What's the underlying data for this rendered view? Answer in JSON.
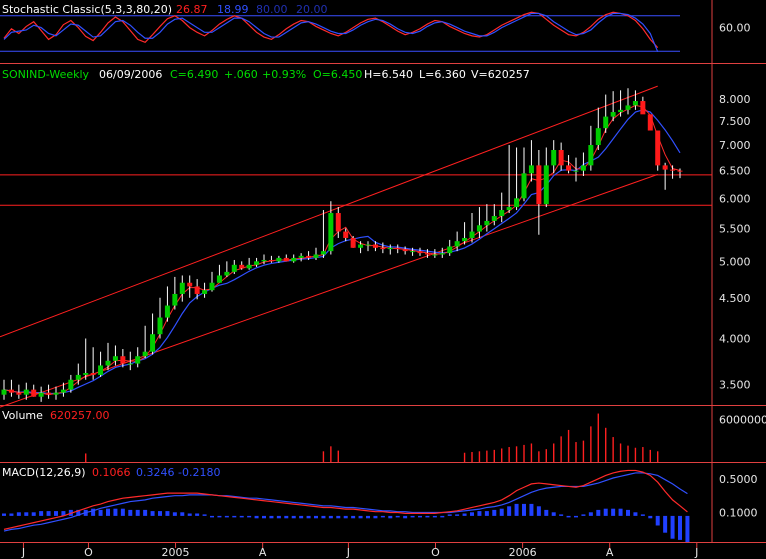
{
  "colors": {
    "background": "#000000",
    "up": "#00cc00",
    "down": "#ff1a1a",
    "channel": "#ff2020",
    "ma_fast": "#ff2a2a",
    "ma_slow": "#3050ff",
    "axis_text": "#e6e6e6",
    "header_text": "#ffffff",
    "price_header": "#00dd00"
  },
  "stoch_panel": {
    "label": "Stochastic Classic(5,3,3,80,20)",
    "k": "26.87",
    "d": "18.99",
    "upper": "80.00",
    "lower": "20.00"
  },
  "price_panel": {
    "symbol": "SONIND-Weekly",
    "date": "06/09/2006",
    "close": "C=6.490",
    "change": "+.060",
    "pct": "+0.93%",
    "open": "O=6.450",
    "high": "H=6.540",
    "low": "L=6.360",
    "volume": "V=620257"
  },
  "volume_panel": {
    "label": "Volume",
    "value": "620257.00"
  },
  "macd_panel": {
    "label": "MACD(12,26,9)",
    "macd": "0.1066",
    "signal": "0.3246",
    "hist": "-0.2180"
  },
  "chart_data": [
    {
      "type": "line",
      "panel": "stochastic",
      "y_ticks": [
        "60.00"
      ],
      "ylim": [
        0,
        100
      ],
      "reference_lines": [
        80,
        20
      ],
      "series": [
        {
          "values": [
            42,
            58,
            50,
            62,
            70,
            55,
            40,
            48,
            65,
            72,
            60,
            45,
            38,
            52,
            68,
            78,
            70,
            55,
            40,
            35,
            48,
            62,
            75,
            80,
            72,
            60,
            52,
            46,
            55,
            66,
            74,
            80,
            76,
            64,
            52,
            44,
            40,
            48,
            58,
            66,
            72,
            70,
            62,
            56,
            50,
            46,
            52,
            60,
            68,
            74,
            76,
            70,
            62,
            54,
            48,
            52,
            58,
            66,
            72,
            70,
            62,
            56,
            50,
            46,
            44,
            48,
            56,
            64,
            70,
            76,
            82,
            86,
            84,
            74,
            64,
            56,
            48,
            46,
            52,
            62,
            74,
            82,
            86,
            84,
            80,
            72,
            58,
            40,
            26
          ]
        },
        {
          "values": [
            40,
            52,
            54,
            56,
            64,
            60,
            50,
            46,
            56,
            66,
            64,
            54,
            44,
            46,
            58,
            70,
            72,
            64,
            52,
            42,
            42,
            52,
            66,
            74,
            76,
            68,
            60,
            52,
            52,
            60,
            68,
            76,
            76,
            70,
            60,
            50,
            44,
            44,
            52,
            60,
            68,
            70,
            66,
            60,
            54,
            50,
            50,
            56,
            64,
            70,
            74,
            72,
            66,
            58,
            52,
            50,
            54,
            62,
            68,
            70,
            66,
            60,
            54,
            50,
            46,
            46,
            52,
            60,
            66,
            72,
            78,
            84,
            84,
            80,
            70,
            62,
            54,
            48,
            50,
            56,
            68,
            78,
            84,
            84,
            82,
            76,
            66,
            50,
            19
          ]
        }
      ]
    },
    {
      "type": "candlestick",
      "panel": "price",
      "y_ticks": [
        "8.000",
        "7.500",
        "7.000",
        "6.500",
        "6.000",
        "5.500",
        "5.000",
        "4.500",
        "4.000",
        "3.500"
      ],
      "x_ticks": [
        "J",
        "O",
        "2005",
        "A",
        "J",
        "O",
        "2006",
        "A",
        "J"
      ],
      "scale": "log",
      "ylim": [
        3.3,
        8.4
      ],
      "horizontal_lines": [
        6.42,
        5.88
      ],
      "channel": [
        {
          "from": [
            0,
            4.02
          ],
          "to": [
            88,
            8.3
          ]
        },
        {
          "from": [
            0,
            3.28
          ],
          "to": [
            88,
            6.43
          ]
        }
      ],
      "opens": [
        3.4,
        3.45,
        3.42,
        3.4,
        3.45,
        3.38,
        3.42,
        3.4,
        3.42,
        3.45,
        3.55,
        3.6,
        3.62,
        3.6,
        3.7,
        3.75,
        3.8,
        3.72,
        3.72,
        3.8,
        3.85,
        4.05,
        4.25,
        4.4,
        4.55,
        4.7,
        4.65,
        4.55,
        4.6,
        4.7,
        4.8,
        4.85,
        4.95,
        4.9,
        4.95,
        5.0,
        5.02,
        5.0,
        5.05,
        5.0,
        5.05,
        5.08,
        5.05,
        5.1,
        5.15,
        5.75,
        5.45,
        5.35,
        5.2,
        5.25,
        5.25,
        5.2,
        5.18,
        5.2,
        5.18,
        5.15,
        5.15,
        5.12,
        5.1,
        5.1,
        5.12,
        5.22,
        5.3,
        5.35,
        5.45,
        5.55,
        5.62,
        5.7,
        5.8,
        5.85,
        6.0,
        6.45,
        6.6,
        5.9,
        6.6,
        6.9,
        6.6,
        6.5,
        6.5,
        6.6,
        7.0,
        7.35,
        7.6,
        7.7,
        7.75,
        7.85,
        7.95,
        7.65,
        7.3,
        6.6,
        6.52,
        6.5
      ],
      "highs": [
        3.55,
        3.55,
        3.5,
        3.52,
        3.5,
        3.48,
        3.5,
        3.48,
        3.52,
        3.6,
        3.72,
        4.0,
        3.9,
        3.85,
        3.95,
        3.92,
        3.88,
        3.85,
        3.9,
        4.15,
        4.3,
        4.5,
        4.65,
        4.78,
        4.8,
        4.8,
        4.75,
        4.7,
        4.85,
        4.95,
        5.0,
        5.02,
        5.0,
        5.05,
        5.05,
        5.1,
        5.08,
        5.08,
        5.1,
        5.1,
        5.12,
        5.15,
        5.2,
        5.8,
        5.95,
        5.85,
        5.5,
        5.38,
        5.3,
        5.3,
        5.3,
        5.28,
        5.25,
        5.25,
        5.22,
        5.2,
        5.2,
        5.18,
        5.18,
        5.2,
        5.32,
        5.45,
        5.6,
        5.75,
        5.85,
        5.9,
        5.9,
        6.1,
        7.0,
        6.95,
        6.95,
        7.1,
        6.9,
        6.95,
        7.1,
        7.05,
        6.8,
        6.75,
        6.85,
        7.4,
        7.8,
        8.1,
        8.18,
        8.2,
        8.25,
        8.2,
        8.05,
        7.5,
        6.7,
        6.65,
        6.6,
        6.54
      ],
      "lows": [
        3.35,
        3.38,
        3.36,
        3.35,
        3.38,
        3.33,
        3.36,
        3.35,
        3.38,
        3.42,
        3.5,
        3.55,
        3.55,
        3.58,
        3.65,
        3.7,
        3.68,
        3.65,
        3.68,
        3.78,
        3.82,
        4.0,
        4.2,
        4.35,
        4.45,
        4.5,
        4.48,
        4.5,
        4.58,
        4.7,
        4.78,
        4.82,
        4.88,
        4.88,
        4.92,
        4.96,
        4.98,
        4.98,
        5.0,
        4.98,
        5.0,
        5.02,
        5.02,
        5.05,
        5.1,
        5.35,
        5.3,
        5.2,
        5.12,
        5.15,
        5.15,
        5.12,
        5.1,
        5.12,
        5.1,
        5.08,
        5.08,
        5.05,
        5.05,
        5.05,
        5.08,
        5.15,
        5.25,
        5.28,
        5.35,
        5.45,
        5.55,
        5.6,
        5.75,
        5.8,
        5.95,
        6.3,
        5.4,
        5.85,
        6.45,
        6.5,
        6.45,
        6.3,
        6.4,
        6.5,
        6.9,
        7.25,
        7.5,
        7.6,
        7.65,
        7.75,
        7.85,
        7.55,
        6.5,
        6.15,
        6.35,
        6.36
      ],
      "closes": [
        3.45,
        3.42,
        3.4,
        3.45,
        3.38,
        3.42,
        3.4,
        3.42,
        3.45,
        3.55,
        3.6,
        3.62,
        3.6,
        3.7,
        3.75,
        3.8,
        3.72,
        3.72,
        3.8,
        3.85,
        4.05,
        4.25,
        4.4,
        4.55,
        4.7,
        4.65,
        4.55,
        4.6,
        4.7,
        4.8,
        4.85,
        4.95,
        4.9,
        4.95,
        5.0,
        5.02,
        5.0,
        5.05,
        5.0,
        5.05,
        5.08,
        5.05,
        5.1,
        5.15,
        5.75,
        5.45,
        5.35,
        5.2,
        5.25,
        5.25,
        5.2,
        5.18,
        5.2,
        5.18,
        5.15,
        5.15,
        5.12,
        5.1,
        5.1,
        5.12,
        5.22,
        5.3,
        5.35,
        5.45,
        5.55,
        5.62,
        5.7,
        5.8,
        5.85,
        6.0,
        6.45,
        6.6,
        5.9,
        6.6,
        6.9,
        6.6,
        6.5,
        6.5,
        6.6,
        7.0,
        7.35,
        7.6,
        7.7,
        7.75,
        7.85,
        7.95,
        7.65,
        7.3,
        6.6,
        6.52,
        6.5,
        6.49
      ]
    },
    {
      "type": "bar",
      "panel": "volume",
      "y_ticks": [
        "6000000"
      ],
      "ylim": [
        0,
        8000000
      ],
      "values": [
        800000,
        900000,
        700000,
        850000,
        750000,
        600000,
        700000,
        800000,
        900000,
        1000000,
        1100000,
        1200000,
        1000000,
        900000,
        800000,
        850000,
        700000,
        650000,
        800000,
        900000,
        950000,
        1000000,
        1100000,
        1050000,
        900000,
        800000,
        750000,
        700000,
        800000,
        850000,
        900000,
        800000,
        700000,
        650000,
        700000,
        750000,
        700000,
        650000,
        700000,
        750000,
        800000,
        700000,
        850000,
        1500000,
        2200000,
        1600000,
        1000000,
        900000,
        800000,
        750000,
        700000,
        650000,
        700000,
        650000,
        600000,
        600000,
        650000,
        600000,
        650000,
        700000,
        900000,
        1100000,
        1300000,
        1400000,
        1500000,
        1600000,
        1700000,
        1900000,
        2100000,
        2200000,
        2400000,
        2600000,
        1500000,
        1800000,
        2600000,
        3600000,
        4500000,
        2800000,
        3000000,
        5000000,
        6800000,
        4800000,
        3500000,
        2600000,
        2300000,
        2000000,
        2100000,
        1700000,
        1500000,
        1100000,
        620257
      ]
    },
    {
      "type": "line",
      "panel": "macd",
      "y_ticks": [
        "0.5000",
        "0.1000"
      ],
      "ylim": [
        -0.25,
        0.7
      ],
      "series": [
        {
          "values": [
            -0.1,
            -0.08,
            -0.06,
            -0.04,
            -0.02,
            0.0,
            0.02,
            0.04,
            0.06,
            0.09,
            0.12,
            0.15,
            0.18,
            0.2,
            0.23,
            0.25,
            0.27,
            0.28,
            0.29,
            0.3,
            0.31,
            0.32,
            0.33,
            0.33,
            0.33,
            0.33,
            0.33,
            0.32,
            0.31,
            0.3,
            0.29,
            0.28,
            0.27,
            0.26,
            0.25,
            0.24,
            0.23,
            0.22,
            0.21,
            0.2,
            0.19,
            0.18,
            0.17,
            0.16,
            0.16,
            0.15,
            0.14,
            0.14,
            0.13,
            0.12,
            0.11,
            0.11,
            0.1,
            0.1,
            0.09,
            0.09,
            0.09,
            0.09,
            0.09,
            0.1,
            0.11,
            0.12,
            0.14,
            0.16,
            0.18,
            0.2,
            0.22,
            0.25,
            0.3,
            0.36,
            0.4,
            0.44,
            0.45,
            0.44,
            0.43,
            0.42,
            0.41,
            0.4,
            0.42,
            0.46,
            0.5,
            0.54,
            0.57,
            0.59,
            0.6,
            0.6,
            0.58,
            0.54,
            0.46,
            0.35,
            0.25,
            0.18,
            0.1066
          ]
        },
        {
          "values": [
            -0.12,
            -0.1,
            -0.09,
            -0.07,
            -0.05,
            -0.04,
            -0.02,
            0.0,
            0.02,
            0.04,
            0.07,
            0.1,
            0.12,
            0.15,
            0.17,
            0.19,
            0.21,
            0.23,
            0.24,
            0.25,
            0.27,
            0.28,
            0.29,
            0.3,
            0.3,
            0.31,
            0.31,
            0.31,
            0.31,
            0.3,
            0.3,
            0.29,
            0.28,
            0.27,
            0.27,
            0.26,
            0.25,
            0.24,
            0.23,
            0.22,
            0.21,
            0.2,
            0.19,
            0.18,
            0.18,
            0.17,
            0.16,
            0.16,
            0.15,
            0.14,
            0.13,
            0.12,
            0.12,
            0.11,
            0.11,
            0.1,
            0.1,
            0.1,
            0.1,
            0.1,
            0.1,
            0.11,
            0.12,
            0.13,
            0.14,
            0.16,
            0.17,
            0.19,
            0.22,
            0.26,
            0.3,
            0.34,
            0.37,
            0.39,
            0.4,
            0.41,
            0.41,
            0.41,
            0.41,
            0.43,
            0.45,
            0.48,
            0.51,
            0.53,
            0.55,
            0.57,
            0.57,
            0.56,
            0.54,
            0.49,
            0.44,
            0.38,
            0.3246
          ]
        }
      ],
      "histogram": "macd_minus_signal"
    }
  ]
}
